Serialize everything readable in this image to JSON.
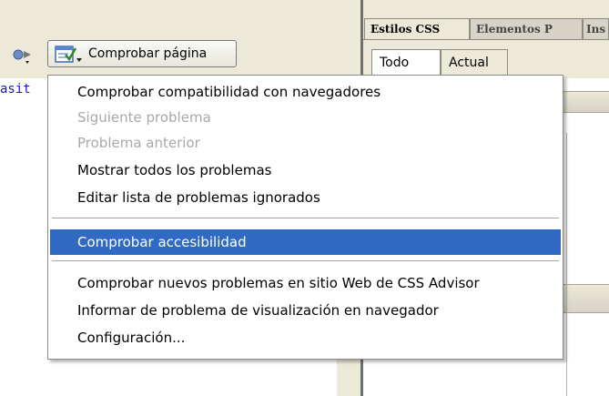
{
  "toolbar": {
    "check_page_label": "Comprobar página",
    "left_icon": "browser-compat-icon",
    "check_icon": "check-page-icon"
  },
  "editor": {
    "code_fragment": "asit"
  },
  "panel": {
    "tabs": [
      {
        "label": "Estilos CSS",
        "active": true
      },
      {
        "label": "Elementos P",
        "active": false
      },
      {
        "label": "Ins",
        "active": false
      }
    ],
    "subtabs": [
      {
        "label": "Todo",
        "active": true
      },
      {
        "label": "Actual",
        "active": false
      }
    ]
  },
  "menu": {
    "items": [
      {
        "label": "Comprobar compatibilidad con navegadores",
        "state": "normal"
      },
      {
        "label": "Siguiente problema",
        "state": "disabled"
      },
      {
        "label": "Problema anterior",
        "state": "disabled"
      },
      {
        "label": "Mostrar todos los problemas",
        "state": "normal"
      },
      {
        "label": "Editar lista de problemas ignorados",
        "state": "normal"
      },
      {
        "label": "Comprobar accesibilidad",
        "state": "selected"
      },
      {
        "label": "Comprobar nuevos problemas en sitio Web de CSS Advisor",
        "state": "normal"
      },
      {
        "label": "Informar de problema de visualización en navegador",
        "state": "normal"
      },
      {
        "label": "Configuración...",
        "state": "normal"
      }
    ]
  },
  "colors": {
    "selection": "#316ac5",
    "chrome": "#ece9d8",
    "disabled_text": "#a8a8a8"
  }
}
